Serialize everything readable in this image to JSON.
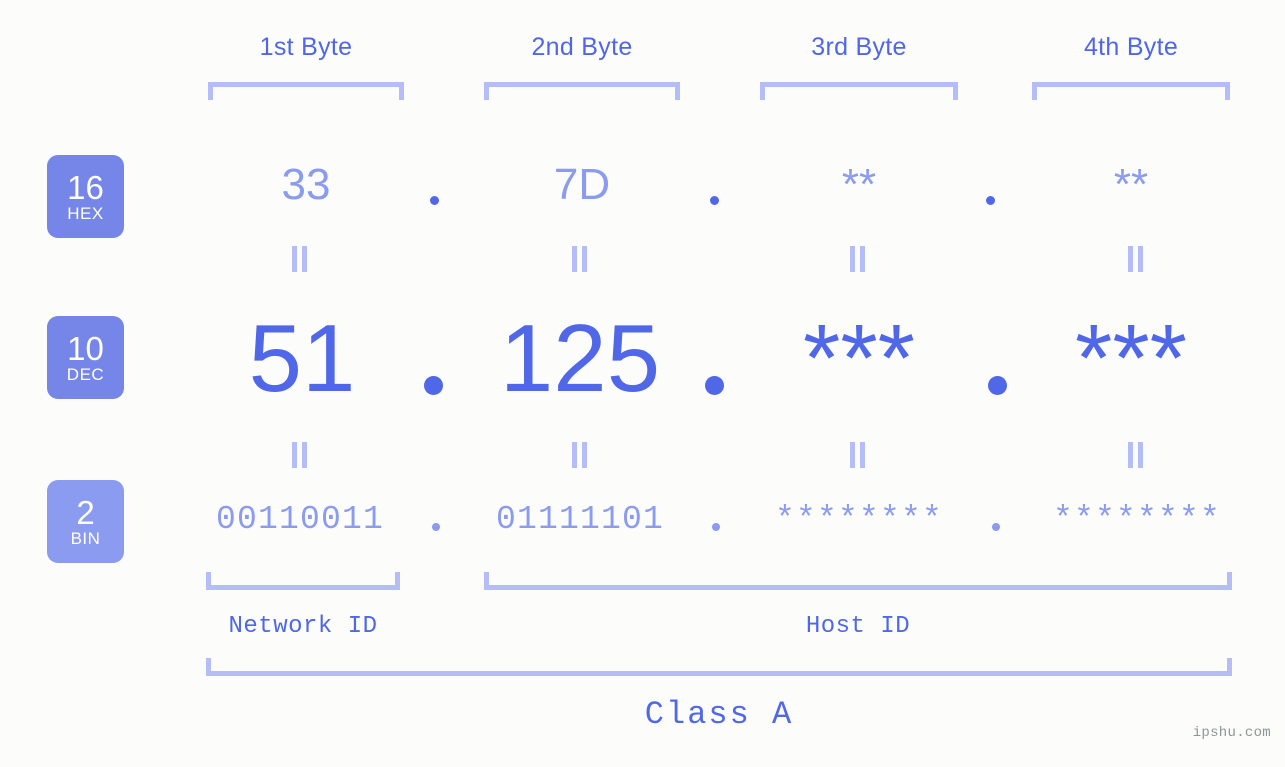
{
  "meta": {
    "watermark": "ipshu.com",
    "colors": {
      "background": "#fcfdfa",
      "accent_strong": "#5068e8",
      "accent_mid": "#8b9bf0",
      "accent_light": "#b4bdf7",
      "badge_fill": "#7586e8",
      "badge_fill_light": "#8b9bf0",
      "watermark": "#8e9596"
    }
  },
  "byte_headers": [
    {
      "label": "1st Byte"
    },
    {
      "label": "2nd Byte"
    },
    {
      "label": "3rd Byte"
    },
    {
      "label": "4th Byte"
    }
  ],
  "radix_badges": [
    {
      "number": "16",
      "name": "HEX"
    },
    {
      "number": "10",
      "name": "DEC"
    },
    {
      "number": "2",
      "name": "BIN"
    }
  ],
  "rows": {
    "hex": {
      "radix": "16",
      "radix_name": "HEX",
      "values": [
        "33",
        "7D",
        "**",
        "**"
      ],
      "separator": "."
    },
    "dec": {
      "radix": "10",
      "radix_name": "DEC",
      "values": [
        "51",
        "125",
        "***",
        "***"
      ],
      "separator": "."
    },
    "bin": {
      "radix": "2",
      "radix_name": "BIN",
      "values": [
        "00110011",
        "01111101",
        "********",
        "********"
      ],
      "separator": "."
    }
  },
  "equality_marker": "||",
  "sections": [
    {
      "label": "Network ID",
      "bytes": [
        1
      ]
    },
    {
      "label": "Host ID",
      "bytes": [
        2,
        3,
        4
      ]
    }
  ],
  "class": {
    "label": "Class A"
  }
}
